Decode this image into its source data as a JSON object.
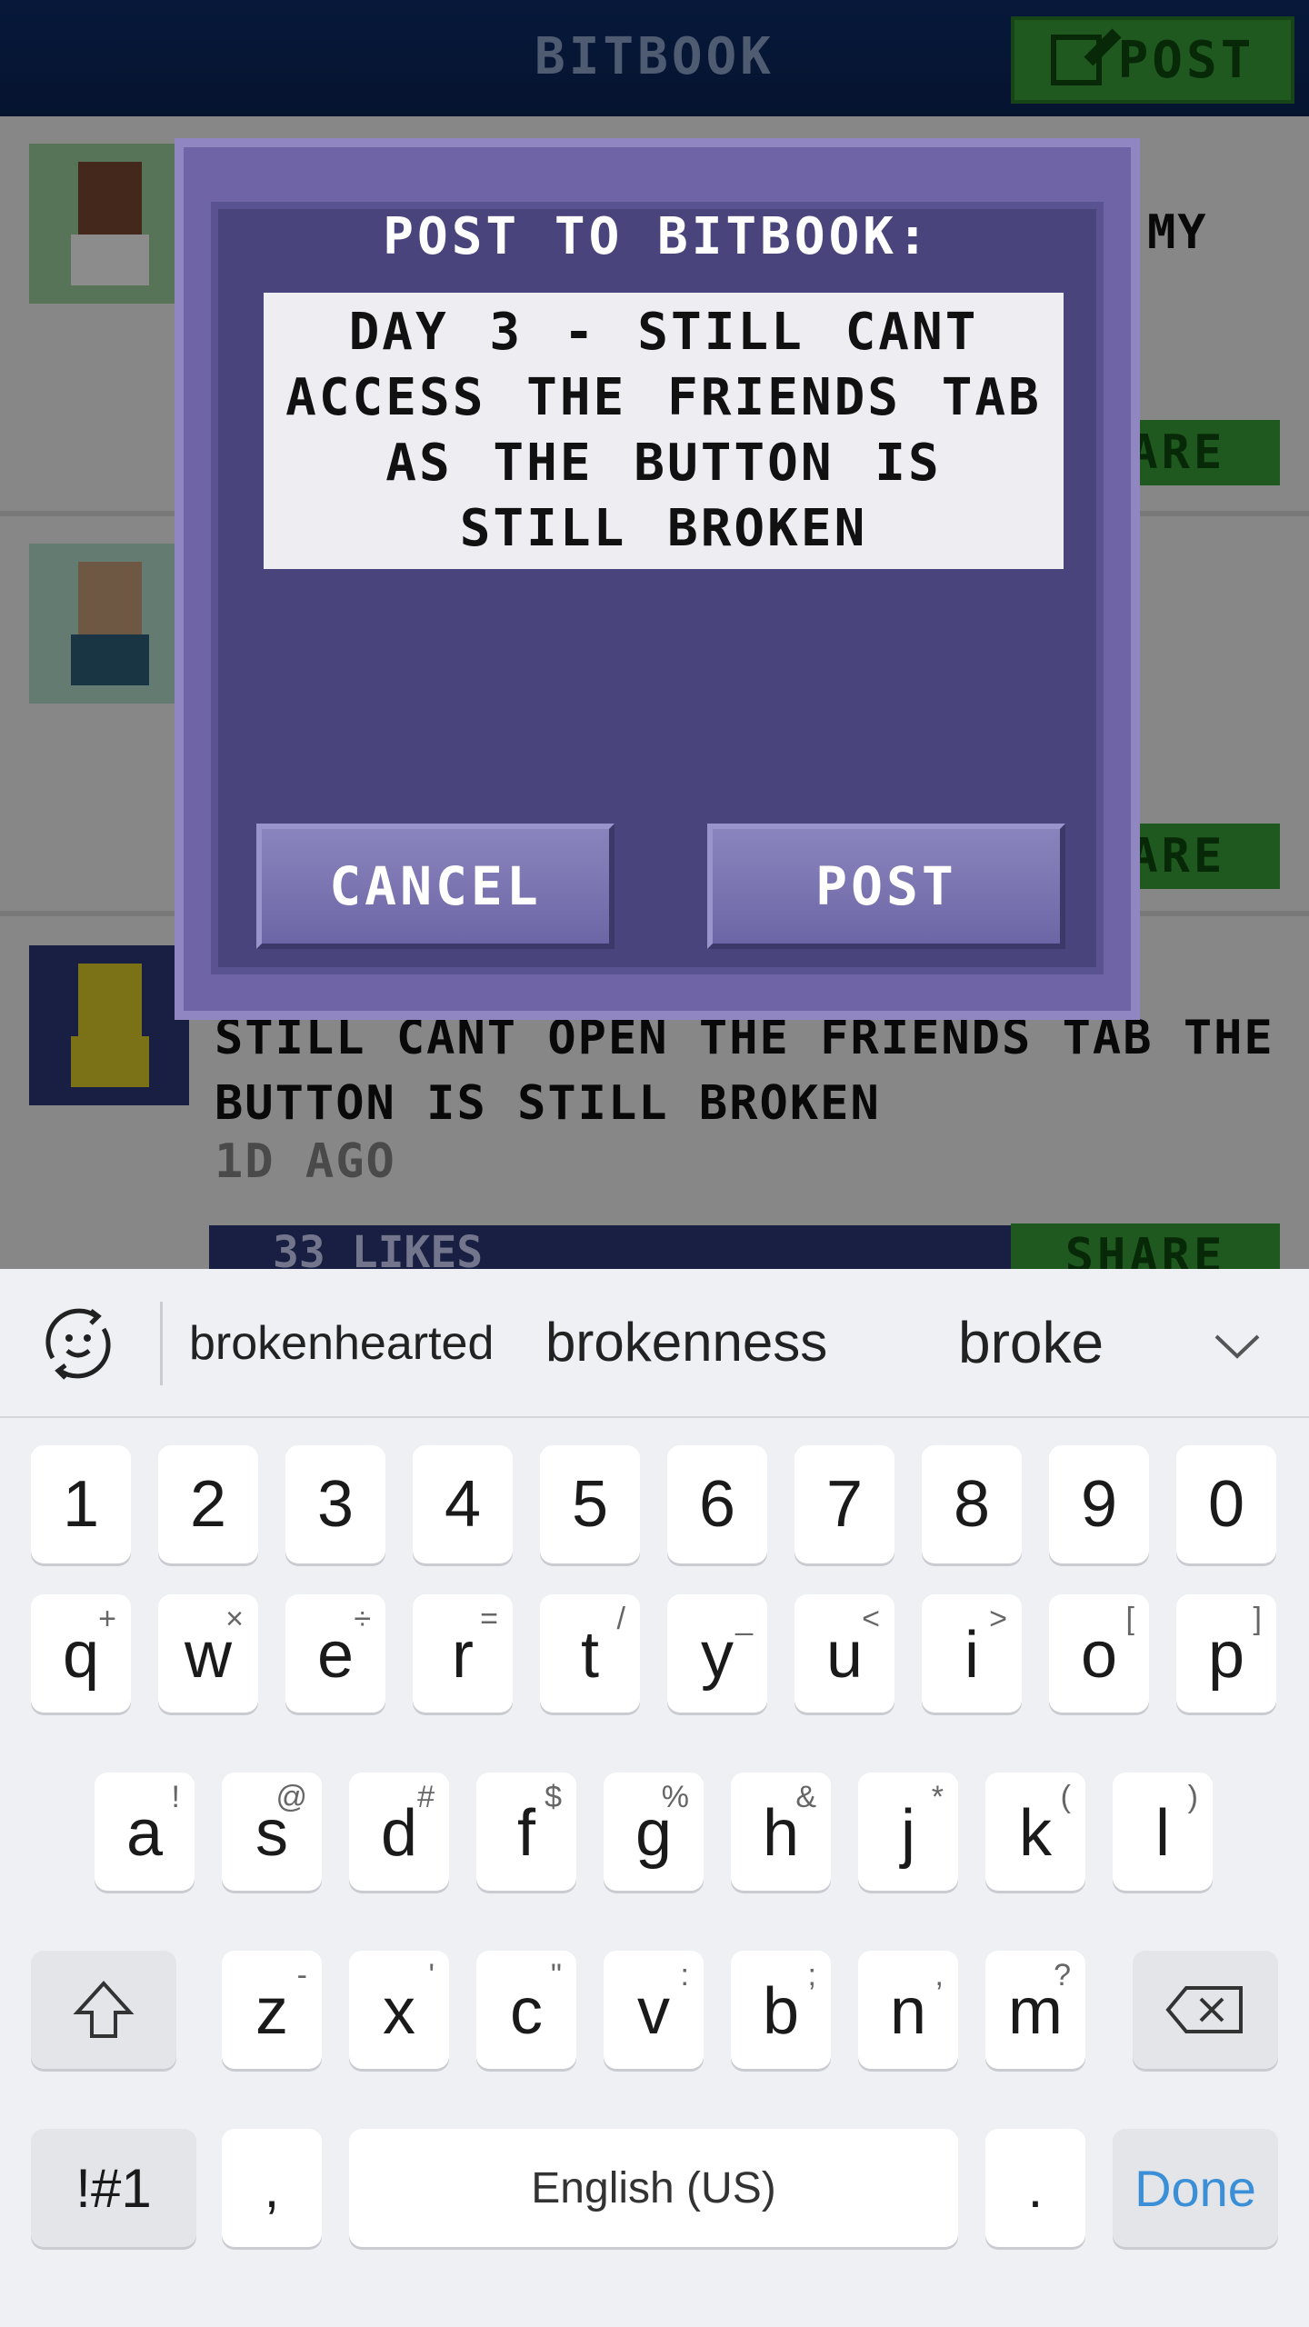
{
  "app": {
    "title": "BITBOOK",
    "post_button": "POST",
    "feed": [
      {
        "text": "MY",
        "share": "SHARE"
      },
      {
        "text": "",
        "share": "SHARE"
      },
      {
        "text": "STILL CANT OPEN THE FRIENDS TAB THE BUTTON IS STILL BROKEN",
        "time": "1D AGO",
        "likes": "33 LIKES",
        "share": "SHARE"
      }
    ]
  },
  "dialog": {
    "title": "POST TO BITBOOK:",
    "input_value": "DAY 3 - STILL CANT ACCESS THE FRIENDS TAB AS THE BUTTON IS STILL BROKEN",
    "cancel_label": "CANCEL",
    "post_label": "POST"
  },
  "keyboard": {
    "suggestions": [
      "brokenhearted",
      "brokenness",
      "broke"
    ],
    "row_numbers": [
      "1",
      "2",
      "3",
      "4",
      "5",
      "6",
      "7",
      "8",
      "9",
      "0"
    ],
    "row_q": [
      {
        "k": "q",
        "s": "+"
      },
      {
        "k": "w",
        "s": "×"
      },
      {
        "k": "e",
        "s": "÷"
      },
      {
        "k": "r",
        "s": "="
      },
      {
        "k": "t",
        "s": "/"
      },
      {
        "k": "y",
        "s": "_"
      },
      {
        "k": "u",
        "s": "<"
      },
      {
        "k": "i",
        "s": ">"
      },
      {
        "k": "o",
        "s": "["
      },
      {
        "k": "p",
        "s": "]"
      }
    ],
    "row_a": [
      {
        "k": "a",
        "s": "!"
      },
      {
        "k": "s",
        "s": "@"
      },
      {
        "k": "d",
        "s": "#"
      },
      {
        "k": "f",
        "s": "$"
      },
      {
        "k": "g",
        "s": "%"
      },
      {
        "k": "h",
        "s": "&"
      },
      {
        "k": "j",
        "s": "*"
      },
      {
        "k": "k",
        "s": "("
      },
      {
        "k": "l",
        "s": ")"
      }
    ],
    "row_z": [
      {
        "k": "z",
        "s": "-"
      },
      {
        "k": "x",
        "s": "'"
      },
      {
        "k": "c",
        "s": "\""
      },
      {
        "k": "v",
        "s": ":"
      },
      {
        "k": "b",
        "s": ";"
      },
      {
        "k": "n",
        "s": ","
      },
      {
        "k": "m",
        "s": "?"
      }
    ],
    "symbols_label": "!#1",
    "comma_label": ",",
    "space_label": "English (US)",
    "period_label": ".",
    "done_label": "Done",
    "icons": {
      "shift": "shift-icon",
      "backspace": "backspace-icon",
      "emoji": "emoji-icon",
      "chevron": "chevron-down-icon"
    }
  }
}
